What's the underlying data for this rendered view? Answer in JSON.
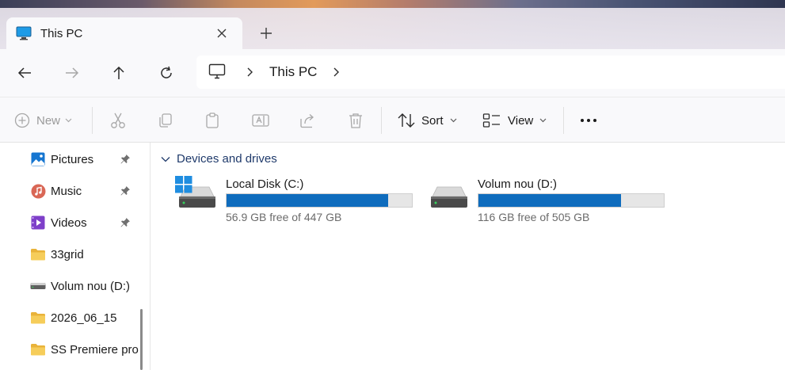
{
  "tab": {
    "title": "This PC"
  },
  "address": {
    "crumb": "This PC"
  },
  "commands": {
    "new_label": "New",
    "sort_label": "Sort",
    "view_label": "View"
  },
  "sidebar": {
    "items": [
      {
        "label": "Pictures",
        "icon": "pictures-icon",
        "pinned": true
      },
      {
        "label": "Music",
        "icon": "music-icon",
        "pinned": true
      },
      {
        "label": "Videos",
        "icon": "videos-icon",
        "pinned": true
      },
      {
        "label": "33grid",
        "icon": "folder-icon",
        "pinned": false
      },
      {
        "label": "Volum nou (D:)",
        "icon": "drive-icon",
        "pinned": false
      },
      {
        "label": "2026_06_15",
        "icon": "folder-icon",
        "pinned": false
      },
      {
        "label": "SS Premiere pro",
        "icon": "folder-icon",
        "pinned": false
      }
    ]
  },
  "main": {
    "group_label": "Devices and drives",
    "drives": [
      {
        "name": "Local Disk (C:)",
        "free_text": "56.9 GB free of 447 GB",
        "used_fraction": 0.873,
        "system": true
      },
      {
        "name": "Volum nou (D:)",
        "free_text": "116 GB free of 505 GB",
        "used_fraction": 0.77,
        "system": false
      }
    ]
  },
  "colors": {
    "accent": "#0f6cbd",
    "folder": "#f4c542",
    "group_header": "#1f3a6b"
  }
}
